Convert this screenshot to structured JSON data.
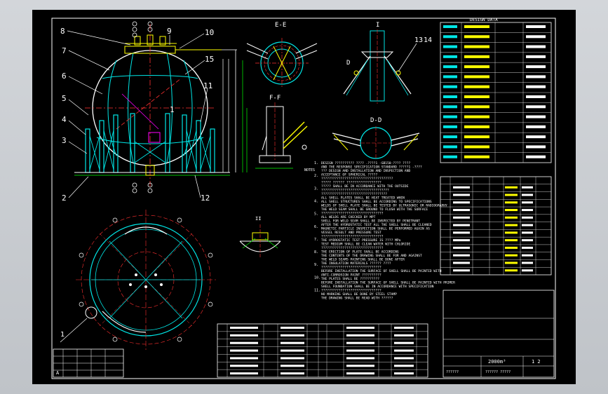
{
  "labels": {
    "balloons": [
      "8",
      "7",
      "6",
      "5",
      "4",
      "3",
      "2",
      "9",
      "10",
      "15",
      "11",
      "12",
      "1"
    ],
    "section_ee": "E-E",
    "section_ff": "F-F",
    "section_dd": "D-D",
    "view_i": "I",
    "view_ii": "II",
    "detail_13": "13",
    "detail_14": "14",
    "small_d": "D",
    "letter_a": "A",
    "notes_header": "NOTES",
    "note_numbers": [
      "1.",
      "2.",
      "3.",
      "4.",
      "5.",
      "6.",
      "7.",
      "8.",
      "9.",
      "10.",
      "11."
    ],
    "note_lines": [
      "DESIGN ?????????? ???? .????1 -GB150-???? ????",
      "AND THE RESPONSE SPECIFICATION STANDARD ?????1 -????",
      "??? DESIGN AND INSTALLATION AND INSPECTION AND",
      "ACCEPTANCE OF SPHERICAL ?????",
      "?????????????????????????????????????",
      "????? ?????? ??????????????????",
      "????? SHALL BE IN ACCORDANCE WITH THE OUTSIDE",
      "???????????????????????????????????",
      "??????????????????????????????????",
      "ALL SHELL PLATES SHALL BE HEAT TREATED WHEN",
      "ALL SHELL STRUCTURES SHALL BE ACCORDING TO SPECIFICATIONS",
      "WELDS OF SHELL PLATE SHALL BE TESTED BY ULTRASONIC OR RADIOGRAPHY",
      "THE WELD SEAM SHALL BE GROUND TO FLUSH WITH THE SURFACE",
      "????????????????????????????????",
      "ALL WELDS ARE CHECKED BY MPT",
      "SHELL FOR WELD SEAM SHALL BE INSPECTED BY PENETRANT",
      "AFTER THE HYDROSTATIC TEST ALL THE SHELL SHALL BE CLEANED",
      "MAGNETIC PARTICLE INSPECTION SHALL BE PERFORMED AGAIN AS",
      "VESSEL RESULT AND PRESSURE TEST",
      "????????????????????????????????",
      "THE HYDROSTATIC TEST PRESSURE IS ???? MPa",
      "TEST MEDIUM SHALL BE CLEAN WATER WITH CHLORIDE",
      "????????????????????????????????",
      "THE ERECTION OF PLATE SHALL BE ACCORDING",
      "THE CONTENTS OF THE DRAWING SHALL BE FOR AND AGAINST",
      "THE WELD SEAMS PAINTING SHALL BE DONE AFTER",
      "THE INSULATION MATERIALS ?????? ????",
      "???????????????????????????????",
      "BEFORE INSTALLATION THE SURFACE OF SHELL SHALL BE PAINTED WITH",
      "ANTI-CORROSION PAINT ??????????",
      "THE PLATES SHALL BE ??????????",
      "BEFORE INSTALLATION THE SURFACE OF SHELL SHALL BE PAINTED WITH PRIMER",
      "SHELL FOUNDATION SHALL BE IN ACCORDANCE WITH SPECIFICATION",
      "???????????????????????????????",
      "NO MARKING SHALL BE DONE BY STEEL STAMP",
      "THE DRAWING SHALL BE READ WITH ??????"
    ],
    "title_block": {
      "drawing_no": "2000m³",
      "sheet": "1 2",
      "line_a": "?????? ?????",
      "line_b": "??????"
    }
  },
  "tables": {
    "design_data_header": "DESIGN DATA",
    "design_data_rows": 14,
    "nozzle_header": "NOZZLE TABLE",
    "nozzle_rows": 13,
    "parts_rows": 7
  }
}
